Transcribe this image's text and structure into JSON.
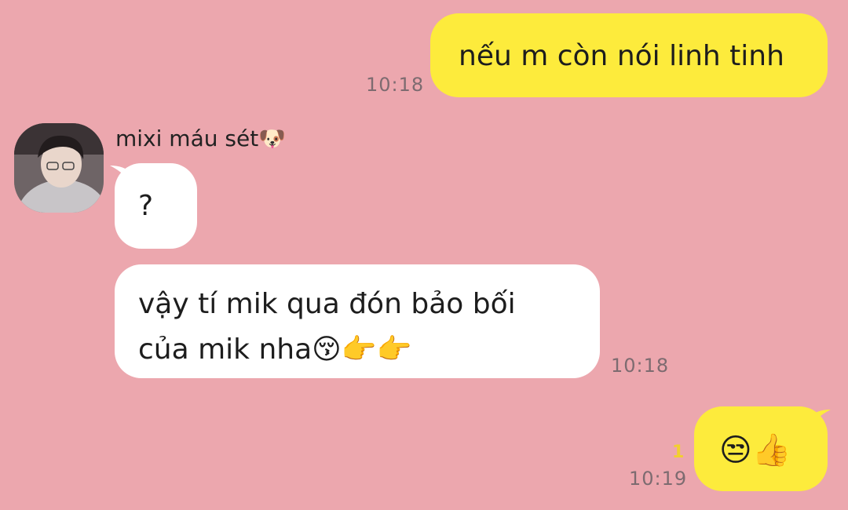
{
  "contact": {
    "name": "mixi máu sét🐶"
  },
  "messages": [
    {
      "direction": "out",
      "text": "nếu m còn nói linh tinh",
      "time": "10:18"
    },
    {
      "direction": "in",
      "text": "?"
    },
    {
      "direction": "in",
      "text_line1": "vậy tí mik qua đón bảo bối",
      "text_line2": "của mik nha😚👉👉",
      "time": "10:18"
    },
    {
      "direction": "out",
      "text": "😒👍",
      "time": "10:19",
      "unread_count": "1"
    }
  ],
  "colors": {
    "background": "#eca7ae",
    "outgoing_bubble": "#fdeb3c",
    "incoming_bubble": "#ffffff",
    "timestamp": "#7d6b70",
    "unread_count": "#f2cf2e"
  }
}
